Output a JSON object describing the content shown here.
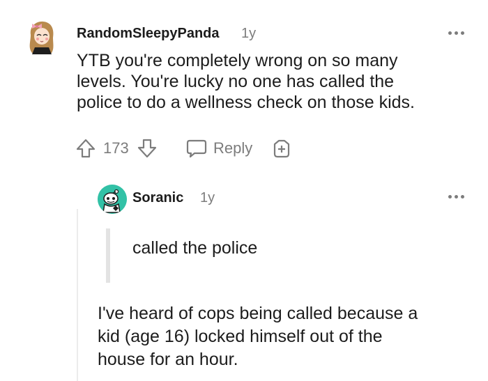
{
  "comment": {
    "author": "RandomSleepyPanda",
    "age": "1y",
    "body_lines": [
      "YTB you're completely wrong on so many",
      "levels. You're lucky no one has called the",
      "police to do a wellness check on those kids."
    ],
    "vote_count": "173",
    "reply_label": "Reply",
    "icons": [
      "more-options-icon",
      "upvote-icon",
      "downvote-icon",
      "reply-bubble-icon",
      "award-icon"
    ]
  },
  "reply": {
    "author": "Soranic",
    "age": "1y",
    "quote": "called the police",
    "body_lines": [
      "I've heard of cops being called because a",
      "kid (age 16) locked himself out of the",
      "house for an hour."
    ],
    "icons": [
      "more-options-icon"
    ]
  },
  "colors": {
    "text": "#1c1c1c",
    "muted": "#7c7c7c",
    "quote_bar": "#e3e3e3",
    "soranic_avatar": "#32c1a6"
  }
}
